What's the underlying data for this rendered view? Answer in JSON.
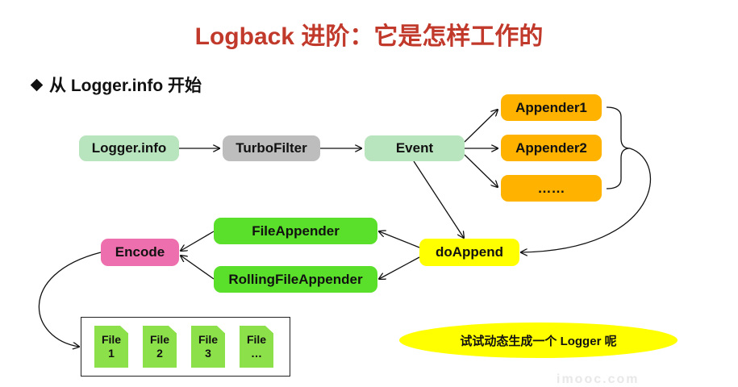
{
  "title": "Logback 进阶：它是怎样工作的",
  "subtitle": "从 Logger.info 开始",
  "nodes": {
    "logger_info": "Logger.info",
    "turbo_filter": "TurboFilter",
    "event": "Event",
    "appender1": "Appender1",
    "appender2": "Appender2",
    "appender_more": "……",
    "file_appender": "FileAppender",
    "rolling_file_appender": "RollingFileAppender",
    "do_append": "doAppend",
    "encode": "Encode"
  },
  "files": [
    {
      "label": "File",
      "num": "1"
    },
    {
      "label": "File",
      "num": "2"
    },
    {
      "label": "File",
      "num": "3"
    },
    {
      "label": "File",
      "num": "…"
    }
  ],
  "callout": "试试动态生成一个 Logger 呢",
  "watermark": "imooc.com",
  "colors": {
    "title": "#c0392b",
    "logger_info": "#b8e4be",
    "turbo_filter": "#bdbdbd",
    "appenders": "#ffb300",
    "file_appenders": "#5ae02a",
    "encode": "#ee6fad",
    "do_append": "#ffff00",
    "files": "#8ce04a"
  }
}
